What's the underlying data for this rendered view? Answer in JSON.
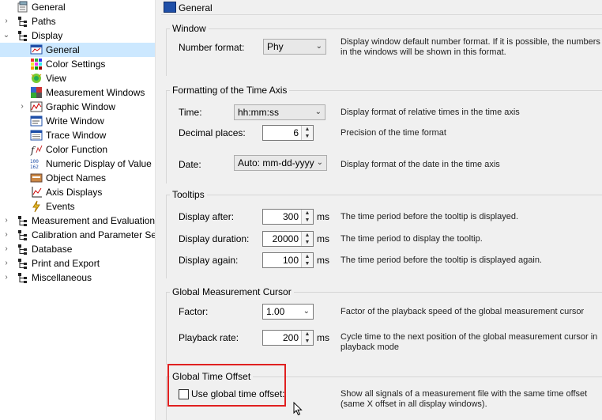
{
  "tree": {
    "items": [
      {
        "label": "General",
        "icon": "settings-doc-icon",
        "level": 0,
        "expander": ""
      },
      {
        "label": "Paths",
        "icon": "tree-node-icon",
        "level": 0,
        "expander": "›"
      },
      {
        "label": "Display",
        "icon": "tree-node-icon",
        "level": 0,
        "expander": "⌄"
      },
      {
        "label": "General",
        "icon": "display-window-icon",
        "level": 1,
        "expander": "",
        "selected": true
      },
      {
        "label": "Color Settings",
        "icon": "color-grid-icon",
        "level": 1,
        "expander": ""
      },
      {
        "label": "View",
        "icon": "view-icon",
        "level": 1,
        "expander": ""
      },
      {
        "label": "Measurement Windows",
        "icon": "measurement-windows-icon",
        "level": 1,
        "expander": ""
      },
      {
        "label": "Graphic Window",
        "icon": "graphic-window-icon",
        "level": 1,
        "expander": "›"
      },
      {
        "label": "Write Window",
        "icon": "write-window-icon",
        "level": 1,
        "expander": ""
      },
      {
        "label": "Trace Window",
        "icon": "trace-window-icon",
        "level": 1,
        "expander": ""
      },
      {
        "label": "Color Function",
        "icon": "color-function-icon",
        "level": 1,
        "expander": ""
      },
      {
        "label": "Numeric Display of Value",
        "icon": "numeric-display-icon",
        "level": 1,
        "expander": ""
      },
      {
        "label": "Object Names",
        "icon": "object-names-icon",
        "level": 1,
        "expander": ""
      },
      {
        "label": "Axis Displays",
        "icon": "axis-displays-icon",
        "level": 1,
        "expander": ""
      },
      {
        "label": "Events",
        "icon": "events-icon",
        "level": 1,
        "expander": ""
      },
      {
        "label": "Measurement and Evaluation",
        "icon": "tree-node-icon",
        "level": 0,
        "expander": "›"
      },
      {
        "label": "Calibration and Parameter Se",
        "icon": "tree-node-icon",
        "level": 0,
        "expander": "›"
      },
      {
        "label": "Database",
        "icon": "tree-node-icon",
        "level": 0,
        "expander": "›"
      },
      {
        "label": "Print and Export",
        "icon": "tree-node-icon",
        "level": 0,
        "expander": "›"
      },
      {
        "label": "Miscellaneous",
        "icon": "tree-node-icon",
        "level": 0,
        "expander": "›"
      }
    ]
  },
  "panel": {
    "title": "General",
    "window": {
      "title": "Window",
      "number_format_label": "Number format:",
      "number_format_value": "Phy",
      "number_format_desc": "Display window default number format. If it is possible, the numbers in the windows will be shown in this format."
    },
    "time_axis": {
      "title": "Formatting of the Time Axis",
      "time_label": "Time:",
      "time_value": "hh:mm:ss",
      "time_desc": "Display format of relative times in the time axis",
      "decimal_label": "Decimal places:",
      "decimal_value": "6",
      "decimal_desc": "Precision of the time format",
      "date_label": "Date:",
      "date_value": "Auto: mm-dd-yyyy",
      "date_desc": "Display format of the date in the time axis"
    },
    "tooltips": {
      "title": "Tooltips",
      "after_label": "Display after:",
      "after_value": "300",
      "after_unit": "ms",
      "after_desc": "The time period before the tooltip is displayed.",
      "duration_label": "Display duration:",
      "duration_value": "20000",
      "duration_unit": "ms",
      "duration_desc": "The time period to display the tooltip.",
      "again_label": "Display again:",
      "again_value": "100",
      "again_unit": "ms",
      "again_desc": "The time period before the tooltip is displayed again."
    },
    "cursor": {
      "title": "Global Measurement Cursor",
      "factor_label": "Factor:",
      "factor_value": "1.00",
      "factor_desc": "Factor of the playback speed of the global measurement cursor",
      "rate_label": "Playback rate:",
      "rate_value": "200",
      "rate_unit": "ms",
      "rate_desc": "Cycle time to the next position of the global measurement cursor in playback mode"
    },
    "time_offset": {
      "title": "Global Time Offset",
      "checkbox_label": "Use global time offset:",
      "checked": false,
      "desc": "Show all signals of a measurement file with the same time offset (same X offset in all display windows)."
    }
  },
  "colors": {
    "selection": "#cce8ff",
    "highlight": "#e02020",
    "panel_bg": "#f0f0f0"
  }
}
